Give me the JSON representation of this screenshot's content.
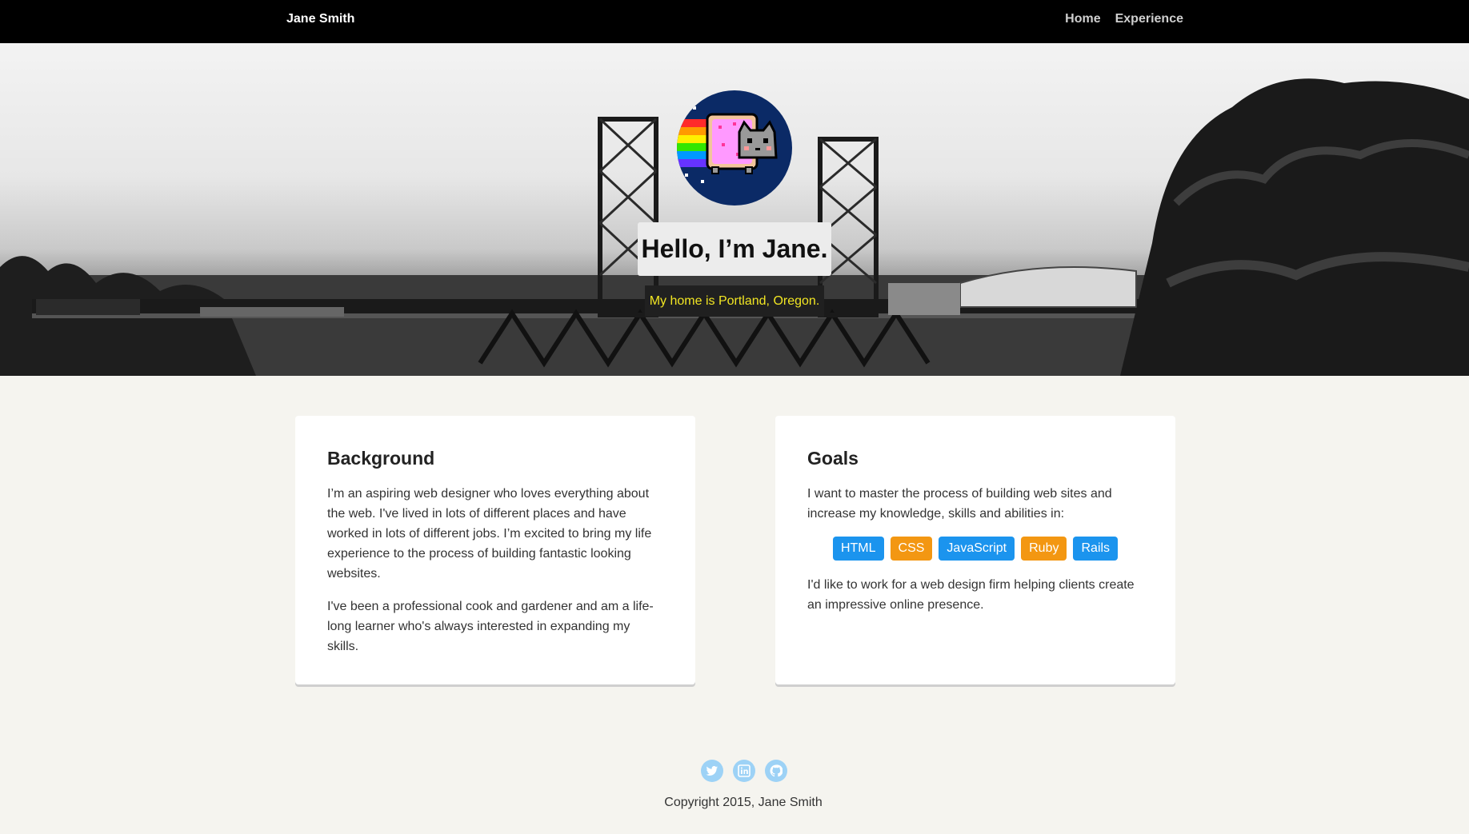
{
  "nav": {
    "brand": "Jane Smith",
    "links": [
      {
        "label": "Home"
      },
      {
        "label": "Experience"
      }
    ]
  },
  "hero": {
    "title": "Hello, I’m Jane.",
    "subtitle": "My home is Portland, Oregon.",
    "avatar_icon": "nyan-cat-icon"
  },
  "background": {
    "heading": "Background",
    "paragraphs": [
      "I’m an aspiring web designer who loves everything about the web. I've lived in lots of different places and have worked in lots of different jobs. I’m excited to bring my life experience to the process of building fantastic looking websites.",
      "I've been a professional cook and gardener and am a life-long learner who's always interested in expanding my skills."
    ]
  },
  "goals": {
    "heading": "Goals",
    "intro": "I want to master the process of building web sites and increase my knowledge, skills and abilities in:",
    "tags": [
      "HTML",
      "CSS",
      "JavaScript",
      "Ruby",
      "Rails"
    ],
    "outro": "I'd like to work for a web design firm helping clients create an impressive online presence."
  },
  "footer": {
    "socials": [
      "twitter-icon",
      "linkedin-icon",
      "github-icon"
    ],
    "copyright": "Copyright 2015, Jane Smith"
  },
  "colors": {
    "nav_bg": "#000000",
    "page_bg": "#f5f4ef",
    "tag_blue": "#1b94ee",
    "tag_orange": "#f39712",
    "subtitle_text": "#f2e623",
    "social_icon_bg": "#9dd2f6"
  }
}
